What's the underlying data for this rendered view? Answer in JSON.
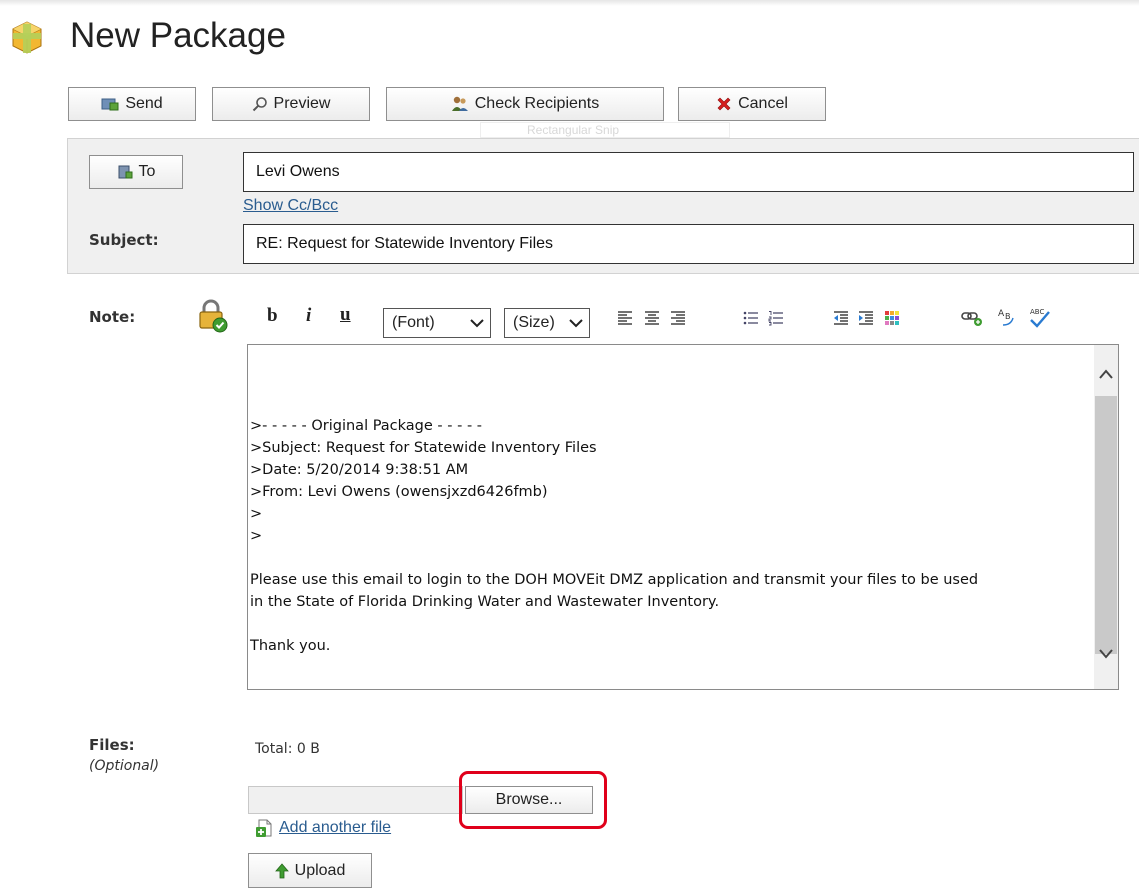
{
  "page": {
    "title": "New Package"
  },
  "actions": {
    "send": "Send",
    "preview": "Preview",
    "check_recipients": "Check Recipients",
    "cancel": "Cancel"
  },
  "overlay": {
    "snip_label": "Rectangular Snip"
  },
  "header": {
    "to_button": "To",
    "to_value": "Levi Owens",
    "show_cc_bcc": "Show Cc/Bcc",
    "subject_label": "Subject:",
    "subject_value": "RE: Request for Statewide Inventory Files"
  },
  "note": {
    "label": "Note:",
    "toolbar": {
      "bold": "b",
      "italic": "i",
      "underline": "u",
      "font_select": "(Font)",
      "size_select": "(Size)"
    },
    "body_lines": [
      ">- - - - - Original Package - - - - -",
      ">Subject: Request for Statewide Inventory Files",
      ">Date: 5/20/2014 9:38:51 AM",
      ">From: Levi Owens (owensjxzd6426fmb)",
      ">",
      ">",
      "",
      "Please use this email to login to the DOH MOVEit DMZ application and transmit your files to be used",
      "in the State of Florida Drinking Water and Wastewater Inventory.",
      "",
      "Thank you."
    ]
  },
  "files": {
    "label": "Files:",
    "optional": "(Optional)",
    "total": "Total: 0 B",
    "browse": "Browse...",
    "add_another": "Add another file",
    "upload": "Upload"
  },
  "colors": {
    "link": "#2a5c8f",
    "highlight": "#e0001b",
    "panel": "#f0f0f0"
  }
}
